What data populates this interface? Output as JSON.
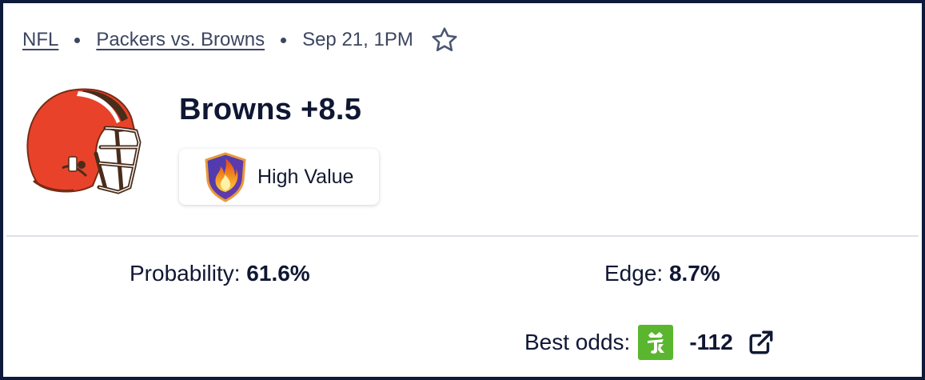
{
  "breadcrumb": {
    "league": "NFL",
    "matchup": "Packers vs. Browns",
    "datetime": "Sep 21, 1PM"
  },
  "pick": {
    "title": "Browns +8.5",
    "team_logo": "browns-helmet-icon",
    "badge_label": "High Value",
    "badge_icon": "flame-shield-icon"
  },
  "stats": {
    "probability_label": "Probability:",
    "probability_value": "61.6%",
    "edge_label": "Edge:",
    "edge_value": "8.7%"
  },
  "best_odds": {
    "label": "Best odds:",
    "sportsbook_icon": "draftkings-icon",
    "value": "-112",
    "link_icon": "external-link-icon"
  },
  "colors": {
    "border": "#0e1a3a",
    "text": "#0f1733",
    "muted": "#3c4660",
    "browns_orange": "#e8432a",
    "browns_brown": "#4a2c1a",
    "draftkings_green": "#5ab62e"
  }
}
